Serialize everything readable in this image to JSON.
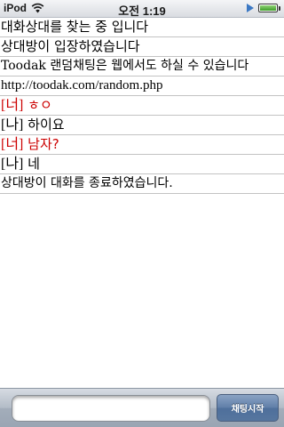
{
  "status_bar": {
    "carrier": "iPod",
    "time": "오전 1:19",
    "battery_level": 1.0,
    "icons": [
      "wifi-icon",
      "play-icon",
      "battery-icon"
    ]
  },
  "chat": {
    "lines": [
      {
        "kind": "notice",
        "text": "대화상대를 찾는 중 입니다"
      },
      {
        "kind": "notice",
        "text": "상대방이 입장하였습니다"
      },
      {
        "kind": "plain",
        "text": "Toodak 랜덤채팅은 웹에서도 하실 수 있습니다"
      },
      {
        "kind": "url",
        "text": "http://toodak.com/random.php"
      },
      {
        "kind": "message",
        "speaker": "[너]",
        "speaker_role": "other",
        "text": "ㅎㅇ"
      },
      {
        "kind": "message",
        "speaker": "[나]",
        "speaker_role": "me",
        "text": "하이요"
      },
      {
        "kind": "message",
        "speaker": "[너]",
        "speaker_role": "other",
        "text": "남자?"
      },
      {
        "kind": "message",
        "speaker": "[나]",
        "speaker_role": "me",
        "text": "네"
      },
      {
        "kind": "plain",
        "text": "상대방이 대화를 종료하였습니다."
      }
    ]
  },
  "bottom_bar": {
    "input_value": "",
    "start_button_label": "채팅시작"
  },
  "colors": {
    "other_speaker": "#cc0000",
    "me_speaker": "#000000",
    "divider": "#c3c3c3",
    "button_blue": "#5f7ea8"
  }
}
